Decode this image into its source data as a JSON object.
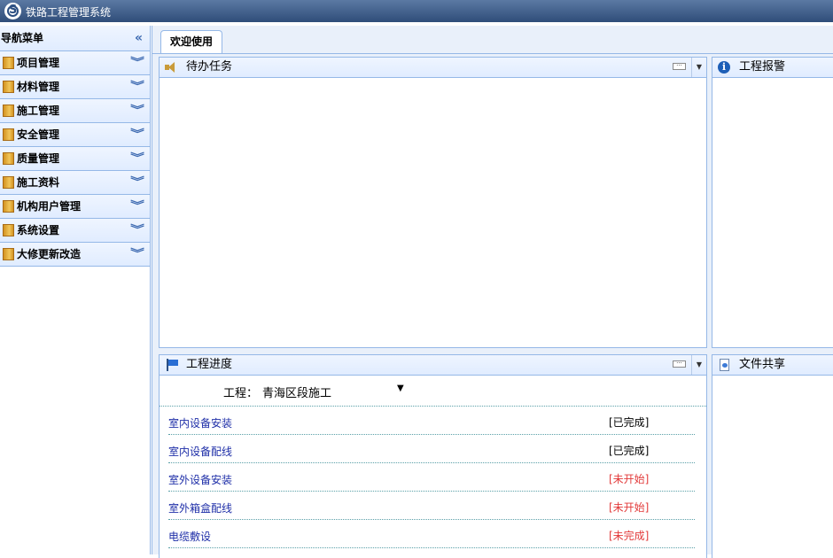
{
  "app": {
    "title": "铁路工程管理系统",
    "logo_icon": "s-logo-icon"
  },
  "sidebar": {
    "header": "导航菜单",
    "collapse_glyph": "«",
    "items": [
      {
        "label": "项目管理"
      },
      {
        "label": "材料管理"
      },
      {
        "label": "施工管理"
      },
      {
        "label": "安全管理"
      },
      {
        "label": "质量管理"
      },
      {
        "label": "施工资料"
      },
      {
        "label": "机构用户管理"
      },
      {
        "label": "系统设置"
      },
      {
        "label": "大修更新改造"
      }
    ],
    "chevron_glyph": "⌄⌄"
  },
  "tabs": [
    {
      "label": "欢迎使用",
      "active": true
    }
  ],
  "panels": {
    "todo": {
      "title": "待办任务"
    },
    "alarm": {
      "title": "工程报警"
    },
    "progress": {
      "title": "工程进度",
      "project_label": "工程：",
      "project_value": "青海区段施工",
      "tasks": [
        {
          "name": "室内设备安装",
          "status": "[已完成]",
          "color": "#000000"
        },
        {
          "name": "室内设备配线",
          "status": "[已完成]",
          "color": "#000000"
        },
        {
          "name": "室外设备安装",
          "status": "[未开始]",
          "color": "#e23a3a"
        },
        {
          "name": "室外箱盒配线",
          "status": "[未开始]",
          "color": "#e23a3a"
        },
        {
          "name": "电缆敷设",
          "status": "[未完成]",
          "color": "#e23a3a"
        }
      ]
    },
    "share": {
      "title": "文件共享"
    }
  },
  "colors": {
    "accent_border": "#95b8e7",
    "title_bar": "#3f5f8c",
    "link": "#1f2fa8",
    "warning": "#e23a3a"
  }
}
